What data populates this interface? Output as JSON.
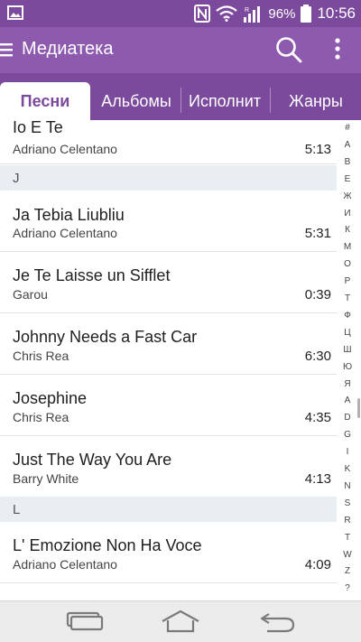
{
  "status": {
    "battery": "96%",
    "time": "10:56"
  },
  "header": {
    "title": "Медиатека"
  },
  "tabs": [
    {
      "label": "Песни"
    },
    {
      "label": "Альбомы"
    },
    {
      "label": "Исполнит"
    },
    {
      "label": "Жанры"
    }
  ],
  "songs": [
    {
      "title": "Io E Te",
      "artist": "Adriano Celentano",
      "duration": "5:13"
    },
    {
      "title": "Ja Tebia Liubliu",
      "artist": "Adriano Celentano",
      "duration": "5:31"
    },
    {
      "title": "Je Te Laisse un Sifflet",
      "artist": "Garou",
      "duration": "0:39"
    },
    {
      "title": "Johnny Needs a Fast Car",
      "artist": "Chris Rea",
      "duration": "6:30"
    },
    {
      "title": "Josephine",
      "artist": "Chris Rea",
      "duration": "4:35"
    },
    {
      "title": "Just The Way You Are",
      "artist": "Barry White",
      "duration": "4:13"
    },
    {
      "title": "L' Emozione Non Ha Voce",
      "artist": "Adriano Celentano",
      "duration": "4:09"
    }
  ],
  "sections": [
    {
      "letter": "J"
    },
    {
      "letter": "L"
    }
  ],
  "index_letters": [
    "#",
    "А",
    "В",
    "Е",
    "Ж",
    "И",
    "К",
    "М",
    "О",
    "Р",
    "Т",
    "Ф",
    "Ц",
    "Ш",
    "Ю",
    "Я",
    "A",
    "D",
    "G",
    "I",
    "K",
    "N",
    "S",
    "R",
    "T",
    "W",
    "Z",
    "?"
  ]
}
